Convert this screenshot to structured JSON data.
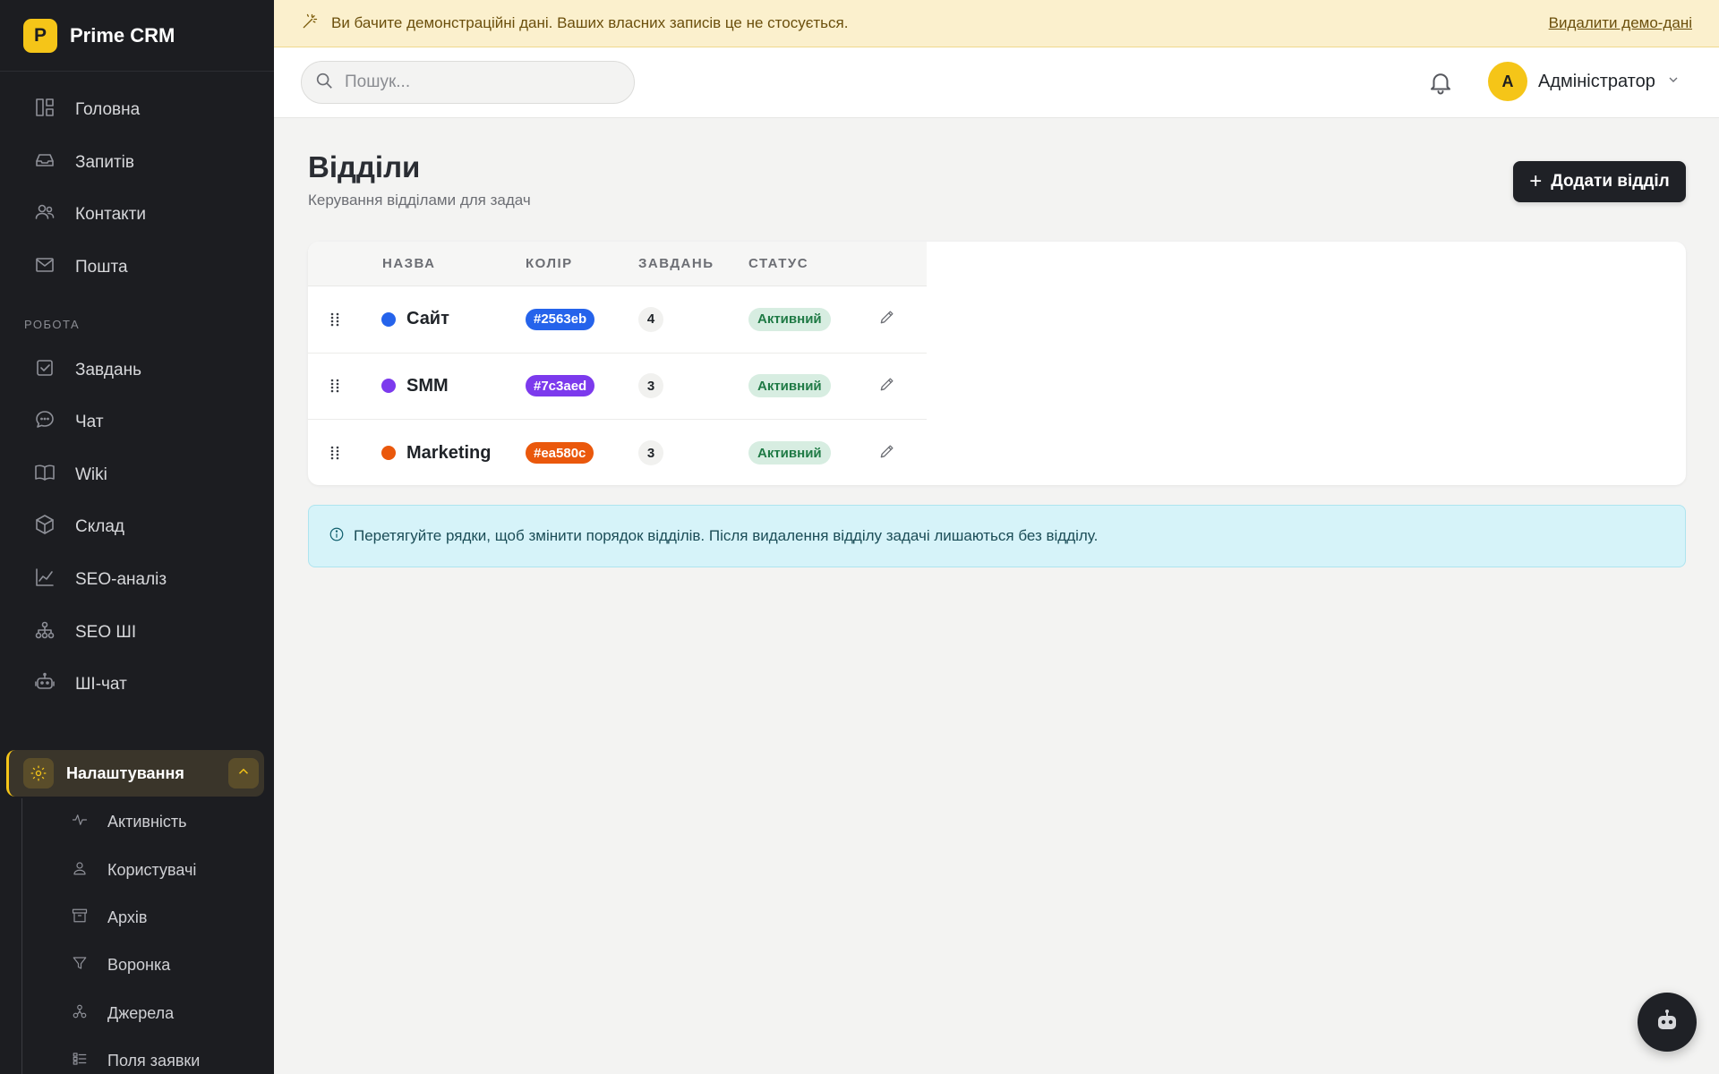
{
  "app": {
    "logo_letter": "P",
    "name": "Prime CRM",
    "accent": "#f5c518"
  },
  "sidebar": {
    "items_top": [
      {
        "label": "Головна",
        "icon": "dashboard-icon"
      },
      {
        "label": "Запитів",
        "icon": "inbox-icon"
      },
      {
        "label": "Контакти",
        "icon": "users-icon"
      },
      {
        "label": "Пошта",
        "icon": "mail-icon"
      }
    ],
    "section_work": "РОБОТА",
    "items_work": [
      {
        "label": "Завдань",
        "icon": "checkbox-icon"
      },
      {
        "label": "Чат",
        "icon": "chat-icon"
      },
      {
        "label": "Wiki",
        "icon": "book-icon"
      },
      {
        "label": "Склад",
        "icon": "box-icon"
      },
      {
        "label": "SEO-аналіз",
        "icon": "chart-line-icon"
      },
      {
        "label": "SEO ШІ",
        "icon": "network-icon"
      },
      {
        "label": "ШІ-чат",
        "icon": "robot-icon"
      }
    ],
    "settings_label": "Налаштування",
    "settings_sub": [
      {
        "label": "Активність",
        "icon": "activity-icon"
      },
      {
        "label": "Користувачі",
        "icon": "user-icon"
      },
      {
        "label": "Архів",
        "icon": "archive-icon"
      },
      {
        "label": "Воронка",
        "icon": "funnel-icon"
      },
      {
        "label": "Джерела",
        "icon": "sources-icon"
      },
      {
        "label": "Поля заявки",
        "icon": "fields-icon"
      }
    ]
  },
  "banner": {
    "text": "Ви бачите демонстраційні дані. Ваших власних записів це не стосується.",
    "link": "Видалити демо-дані"
  },
  "header": {
    "search_placeholder": "Пошук...",
    "user_initial": "А",
    "user_name": "Адміністратор"
  },
  "main": {
    "title": "Відділи",
    "subtitle": "Керування відділами для задач",
    "add_button": "Додати відділ"
  },
  "table": {
    "headers": {
      "name": "НАЗВА",
      "color": "КОЛІР",
      "tasks": "ЗАВДАНЬ",
      "status": "СТАТУС"
    },
    "rows": [
      {
        "name": "Сайт",
        "color": "#2563eb",
        "tasks": "4",
        "status": "Активний"
      },
      {
        "name": "SMM",
        "color": "#7c3aed",
        "tasks": "3",
        "status": "Активний"
      },
      {
        "name": "Marketing",
        "color": "#ea580c",
        "tasks": "3",
        "status": "Активний"
      }
    ]
  },
  "info": {
    "text": "Перетягуйте рядки, щоб змінити порядок відділів. Після видалення відділу задачі лишаються без відділу."
  }
}
